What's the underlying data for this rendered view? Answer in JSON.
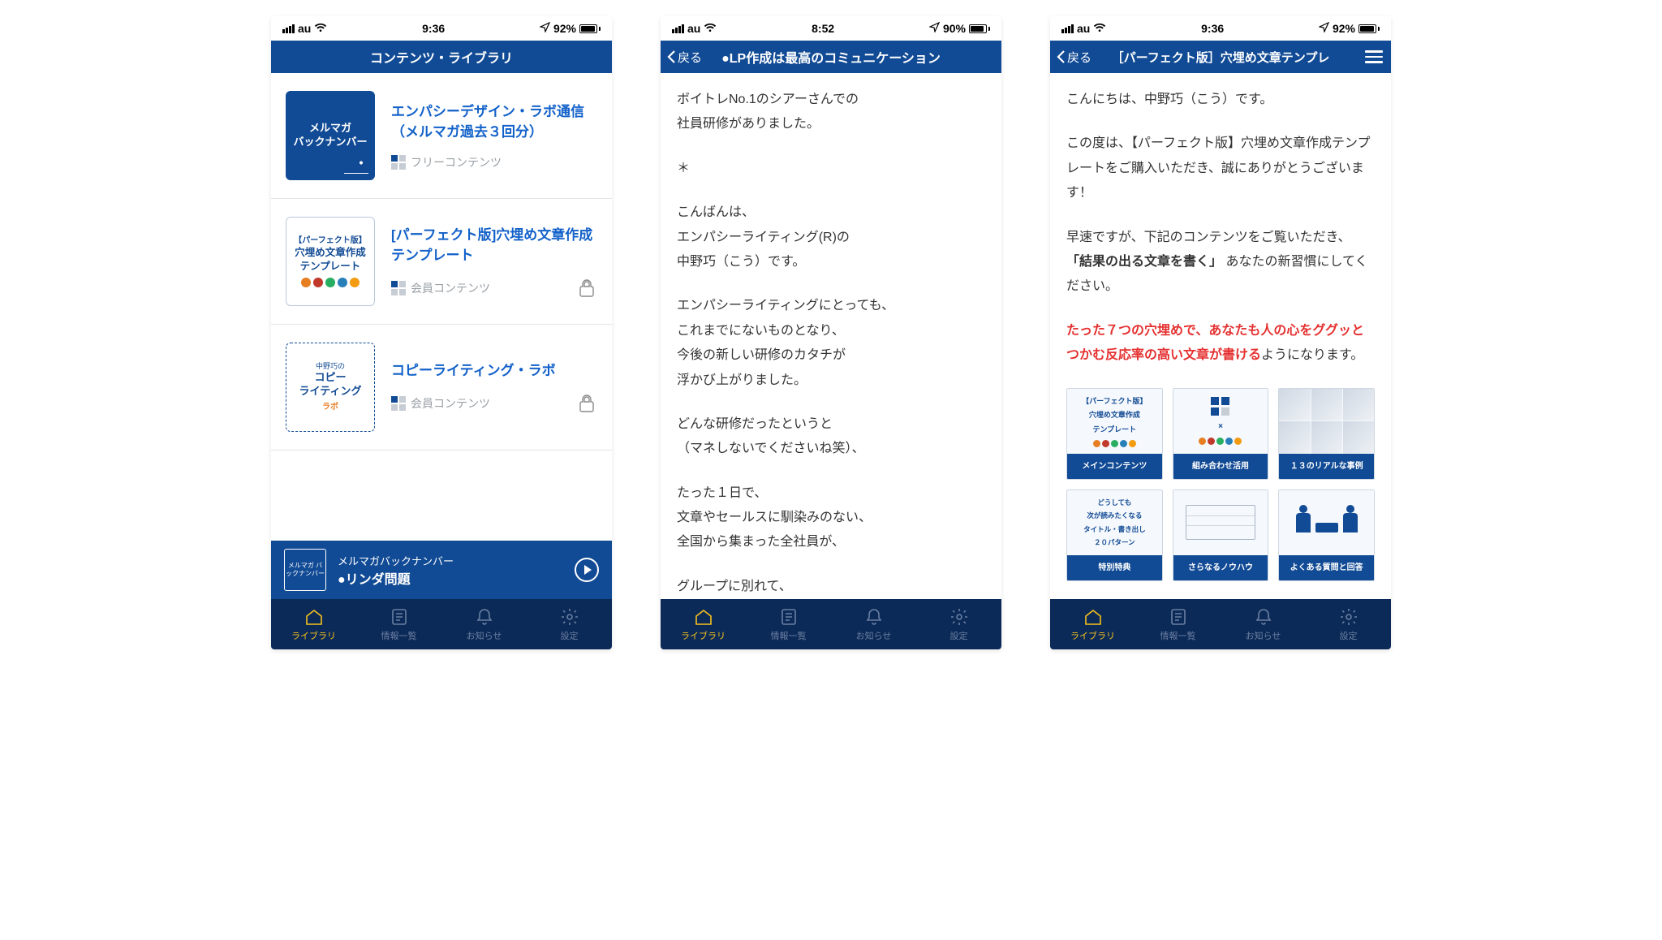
{
  "status": {
    "carrier": "au",
    "time1": "9:36",
    "time2": "8:52",
    "time3": "9:36",
    "battery1": "92%",
    "battery2": "90%",
    "battery3": "92%"
  },
  "tabs": {
    "library": "ライブラリ",
    "info": "情報一覧",
    "notice": "お知らせ",
    "settings": "設定"
  },
  "nav": {
    "back": "戻る",
    "title1": "コンテンツ・ライブラリ",
    "title2": "●LP作成は最高のコミュニケーション",
    "title3": "［パーフェクト版］穴埋め文章テンプレ"
  },
  "screen1": {
    "items": [
      {
        "thumb_line1": "メルマガ",
        "thumb_line2": "バックナンバー",
        "title": "エンパシーデザイン・ラボ通信（メルマガ過去３回分）",
        "tag": "フリーコンテンツ",
        "locked": false,
        "thumb_style": "blue"
      },
      {
        "thumb_line0": "【パーフェクト版】",
        "thumb_line1": "穴埋め文章作成",
        "thumb_line2": "テンプレート",
        "title": "[パーフェクト版]穴埋め文章作成テンプレート",
        "tag": "会員コンテンツ",
        "locked": true,
        "thumb_style": "light"
      },
      {
        "thumb_small": "中野巧の",
        "thumb_line1": "コピー",
        "thumb_line2": "ライティング",
        "thumb_sub": "ラボ",
        "title": "コピーライティング・ラボ",
        "tag": "会員コンテンツ",
        "locked": true,
        "thumb_style": "lab"
      }
    ],
    "now_playing": {
      "thumb": "メルマガ\nバックナンバー",
      "line1": "メルマガバックナンバー",
      "line2": "●リンダ問題"
    }
  },
  "screen2": {
    "p1": "ボイトレNo.1のシアーさんでの\n社員研修がありました。",
    "star": "＊",
    "p2": "こんばんは、\nエンパシーライティング(R)の\n中野巧（こう）です。",
    "p3": "エンパシーライティングにとっても、\nこれまでにないものとなり、\n今後の新しい研修のカタチが\n浮かび上がりました。",
    "p4": "どんな研修だったというと\n（マネしないでくださいね笑）、",
    "p5": "たった１日で、\n文章やセールスに馴染みのない、\n全国から集まった全社員が、",
    "p6": "グループに別れて、"
  },
  "screen3": {
    "p1": "こんにちは、中野巧（こう）です。",
    "p2a": "この度は、【パーフェクト版】穴埋め文章作成テンプレートをご購入いただき、誠にありがとうございます！",
    "p3a": "早速ですが、下記のコンテンツをご覧いただき、",
    "p3b": "「結果の出る文章を書く」",
    "p3c": "あなたの新習慣にしてください。",
    "p4a": "たった７つの穴埋めで、あなたも人の心をググッとつかむ反応率の高い文章が書ける",
    "p4b": "ようになります。",
    "cards": [
      {
        "label": "メインコンテンツ",
        "img_title": "【パーフェクト版】\n穴埋め文章作成\nテンプレート"
      },
      {
        "label": "組み合わせ活用",
        "img_title": ""
      },
      {
        "label": "１３のリアルな事例",
        "img_title": ""
      },
      {
        "label": "特別特典",
        "img_title": "どうしても\n次が読みたくなる\nタイトル・書き出し\n２０パターン"
      },
      {
        "label": "さらなるノウハウ",
        "img_title": ""
      },
      {
        "label": "よくある質問と回答",
        "img_title": ""
      }
    ]
  }
}
